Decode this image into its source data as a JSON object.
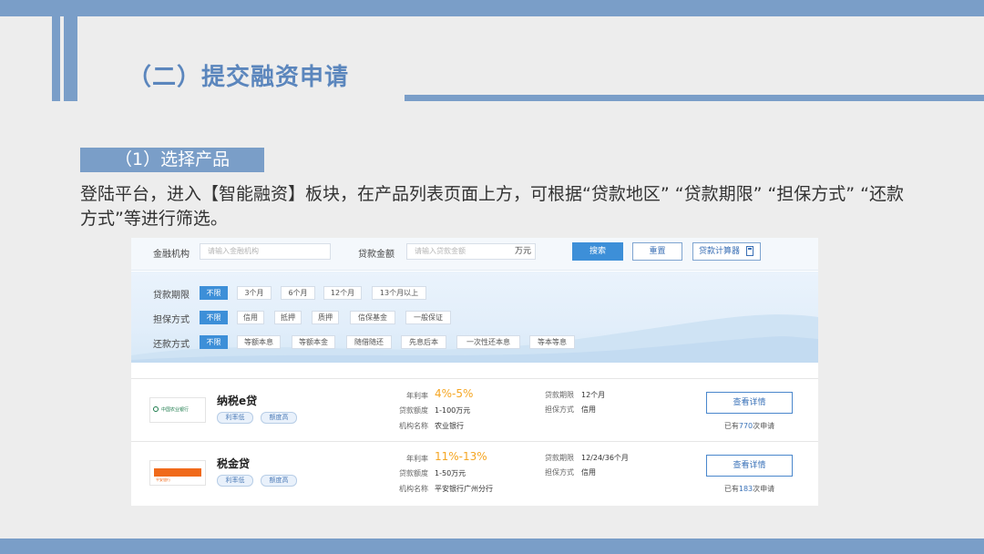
{
  "slide": {
    "title": "（二）提交融资申请",
    "step_label": "（1）选择产品",
    "description": "登陆平台，进入【智能融资】板块，在产品列表页面上方，可根据“贷款地区” “贷款期限” “担保方式” “还款方式”等进行筛选。"
  },
  "search": {
    "institution_label": "金融机构",
    "institution_placeholder": "请输入金融机构",
    "amount_label": "贷款金额",
    "amount_placeholder": "请输入贷款金额",
    "amount_unit": "万元",
    "search_button": "搜索",
    "reset_button": "重置",
    "calculator_button": "贷款计算器"
  },
  "filters": {
    "term": {
      "label": "贷款期限",
      "options": [
        "不限",
        "3个月",
        "6个月",
        "12个月",
        "13个月以上"
      ]
    },
    "guarantee": {
      "label": "担保方式",
      "options": [
        "不限",
        "信用",
        "抵押",
        "质押",
        "信保基金",
        "一般保证"
      ]
    },
    "repayment": {
      "label": "还款方式",
      "options": [
        "不限",
        "等额本息",
        "等额本金",
        "随借随还",
        "先息后本",
        "一次性还本息",
        "等本等息"
      ]
    }
  },
  "products": [
    {
      "name": "纳税e贷",
      "logo_text": "中国农业银行",
      "tags": [
        "利率低",
        "额度高"
      ],
      "rate_label": "年利率",
      "rate": "4%-5%",
      "amount_label": "贷款额度",
      "amount": "1-100万元",
      "org_label": "机构名称",
      "org": "农业银行",
      "term_label": "贷款期限",
      "term": "12个月",
      "guarantee_label": "担保方式",
      "guarantee": "信用",
      "detail_button": "查看详情",
      "applied_prefix": "已有",
      "applied_count": "770",
      "applied_suffix": "次申请"
    },
    {
      "name": "税金贷",
      "logo_text": "平安银行",
      "tags": [
        "利率低",
        "额度高"
      ],
      "rate_label": "年利率",
      "rate": "11%-13%",
      "amount_label": "贷款额度",
      "amount": "1-50万元",
      "org_label": "机构名称",
      "org": "平安银行广州分行",
      "term_label": "贷款期限",
      "term": "12/24/36个月",
      "guarantee_label": "担保方式",
      "guarantee": "信用",
      "detail_button": "查看详情",
      "applied_prefix": "已有",
      "applied_count": "183",
      "applied_suffix": "次申请"
    }
  ],
  "colors": {
    "accent_bar": "#7a9ec8",
    "title_blue": "#5b86bd",
    "primary_button": "#3d8fd8",
    "rate_orange": "#f5a623"
  }
}
